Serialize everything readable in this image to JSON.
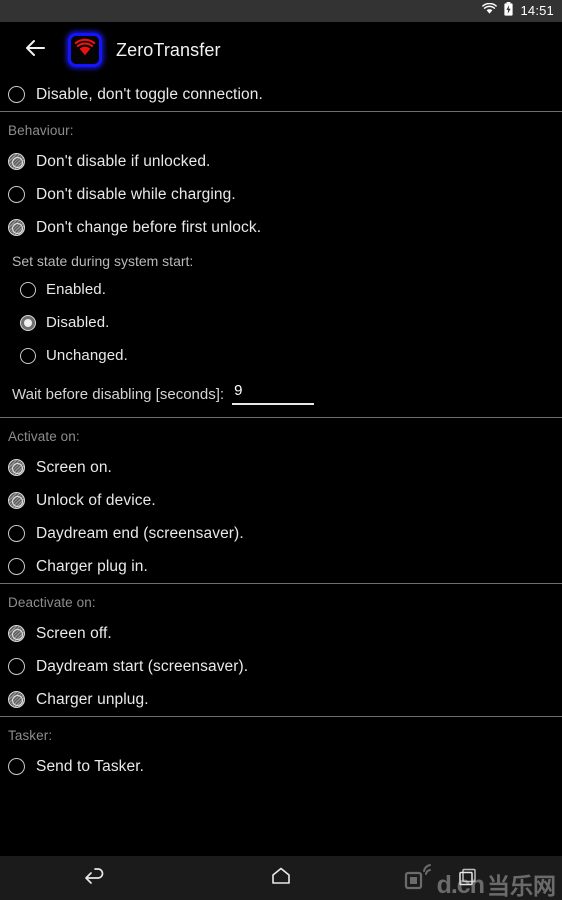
{
  "statusbar": {
    "time": "14:51",
    "wifi_icon": "wifi-icon",
    "battery_icon": "battery-charging-icon"
  },
  "toolbar": {
    "back_icon": "back-arrow-icon",
    "app_icon": "zerotransfer-wifi-icon",
    "title": "ZeroTransfer",
    "icon_border_color": "#1414ff",
    "icon_signal_color": "#ee1111"
  },
  "top_option": {
    "label": "Disable, don't toggle connection.",
    "checked": false
  },
  "sections": [
    {
      "header": "Behaviour:",
      "items": [
        {
          "label": "Don't disable if unlocked.",
          "checked": true
        },
        {
          "label": "Don't disable while charging.",
          "checked": false
        },
        {
          "label": "Don't change before first unlock.",
          "checked": true
        }
      ],
      "subgroup": {
        "header": "Set state during system start:",
        "options": [
          {
            "label": "Enabled.",
            "selected": false
          },
          {
            "label": "Disabled.",
            "selected": true
          },
          {
            "label": "Unchanged.",
            "selected": false
          }
        ]
      },
      "wait_field": {
        "label": "Wait before disabling [seconds]:",
        "value": "9",
        "placeholder": "0"
      }
    },
    {
      "header": "Activate on:",
      "items": [
        {
          "label": "Screen on.",
          "checked": true
        },
        {
          "label": "Unlock of device.",
          "checked": true
        },
        {
          "label": "Daydream end (screensaver).",
          "checked": false
        },
        {
          "label": "Charger plug in.",
          "checked": false
        }
      ]
    },
    {
      "header": "Deactivate on:",
      "items": [
        {
          "label": "Screen off.",
          "checked": true
        },
        {
          "label": "Daydream start (screensaver).",
          "checked": false
        },
        {
          "label": "Charger unplug.",
          "checked": true
        }
      ]
    },
    {
      "header": "Tasker:",
      "items": [
        {
          "label": "Send to Tasker.",
          "checked": false
        }
      ]
    }
  ],
  "navbar": {
    "back_icon": "nav-back-icon",
    "home_icon": "nav-home-icon",
    "recents_icon": "nav-recents-icon"
  },
  "watermark": {
    "text": "d.cn",
    "text_cn": "当乐网",
    "logo_icon": "dcn-logo-icon"
  }
}
